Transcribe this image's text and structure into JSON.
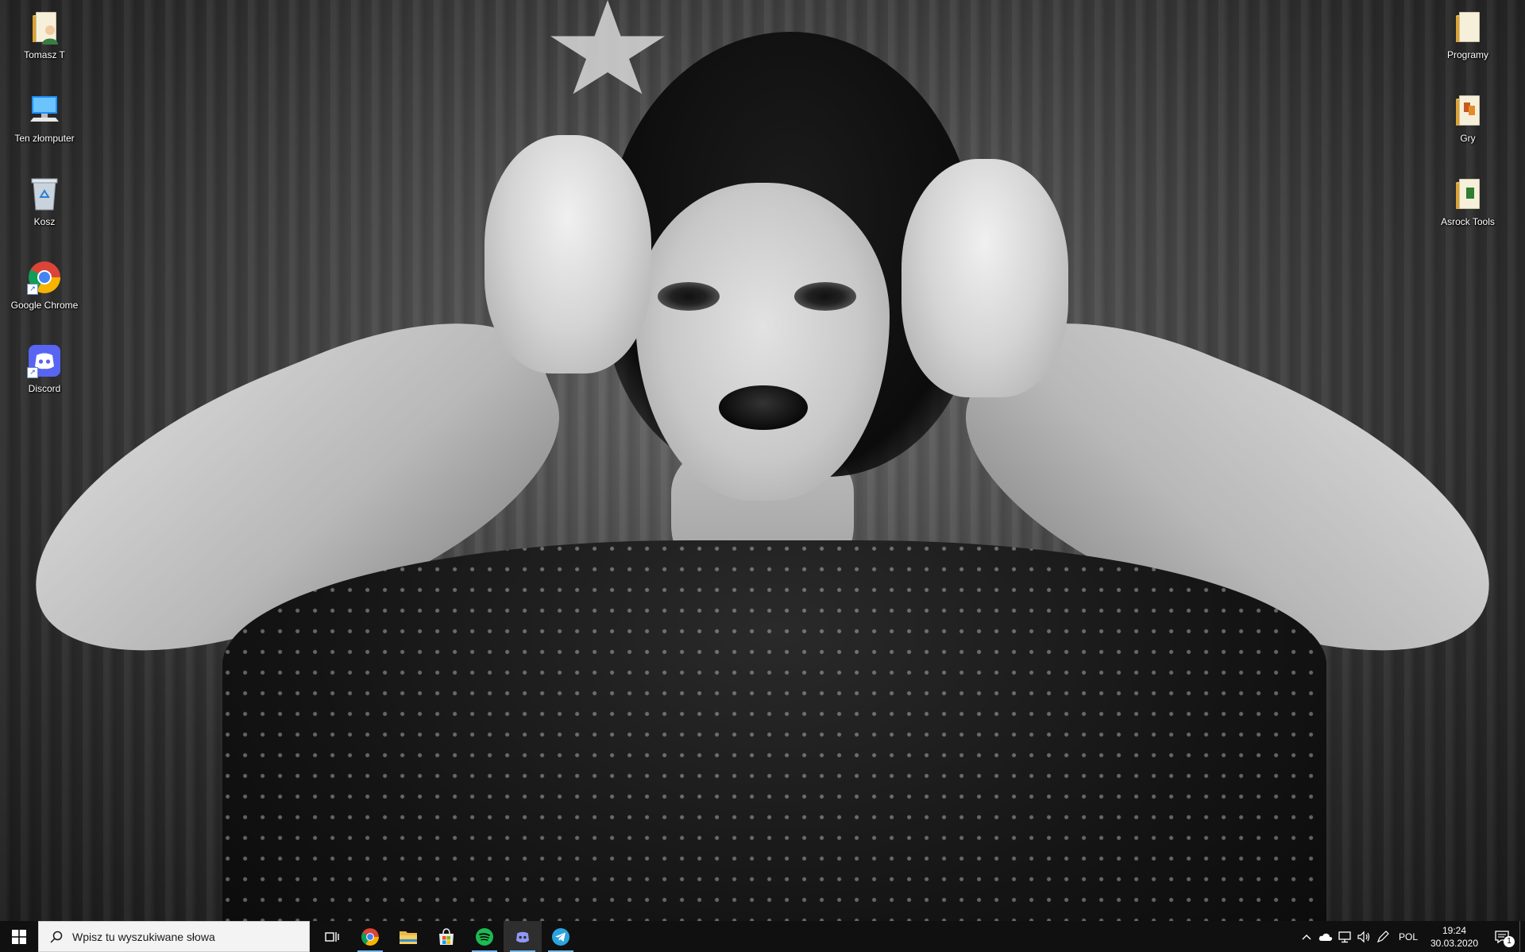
{
  "desktop": {
    "icons_left": [
      {
        "label": "Tomasz T",
        "icon": "user-folder-icon"
      },
      {
        "label": "Ten złomputer",
        "icon": "computer-icon"
      },
      {
        "label": "Kosz",
        "icon": "recycle-bin-icon"
      },
      {
        "label": "Google Chrome",
        "icon": "chrome-icon"
      },
      {
        "label": "Discord",
        "icon": "discord-icon"
      }
    ],
    "icons_right": [
      {
        "label": "Programy",
        "icon": "folder-icon"
      },
      {
        "label": "Gry",
        "icon": "folder-icon"
      },
      {
        "label": "Asrock Tools",
        "icon": "folder-icon"
      }
    ]
  },
  "taskbar": {
    "search_placeholder": "Wpisz tu wyszukiwane słowa",
    "pinned": [
      "task-view",
      "chrome",
      "file-explorer",
      "microsoft-store",
      "spotify",
      "discord",
      "telegram"
    ],
    "active": "discord",
    "tray": {
      "language": "POL",
      "time": "19:24",
      "date": "30.03.2020",
      "notification_count": "1"
    }
  },
  "colors": {
    "taskbar_bg": "#101010",
    "accent": "#76b9ed",
    "chrome_red": "#db4437",
    "chrome_yellow": "#f4b400",
    "chrome_green": "#0f9d58",
    "chrome_blue": "#4285f4",
    "discord": "#5865f2",
    "spotify": "#1db954",
    "telegram": "#2aa3df",
    "folder": "#e9b84a"
  }
}
